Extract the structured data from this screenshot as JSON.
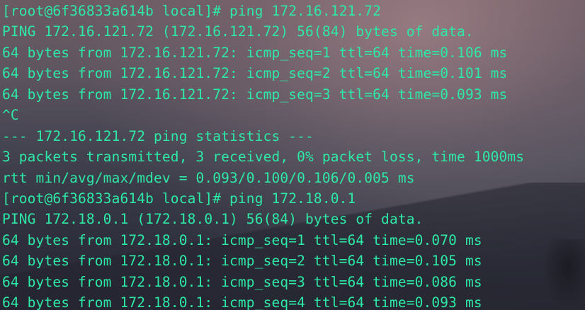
{
  "terminal": {
    "text_color": "#2ee8a6",
    "lines": [
      "[root@6f36833a614b local]# ping 172.16.121.72",
      "PING 172.16.121.72 (172.16.121.72) 56(84) bytes of data.",
      "64 bytes from 172.16.121.72: icmp_seq=1 ttl=64 time=0.106 ms",
      "64 bytes from 172.16.121.72: icmp_seq=2 ttl=64 time=0.101 ms",
      "64 bytes from 172.16.121.72: icmp_seq=3 ttl=64 time=0.093 ms",
      "^C",
      "--- 172.16.121.72 ping statistics ---",
      "3 packets transmitted, 3 received, 0% packet loss, time 1000ms",
      "rtt min/avg/max/mdev = 0.093/0.100/0.106/0.005 ms",
      "[root@6f36833a614b local]# ping 172.18.0.1",
      "PING 172.18.0.1 (172.18.0.1) 56(84) bytes of data.",
      "64 bytes from 172.18.0.1: icmp_seq=1 ttl=64 time=0.070 ms",
      "64 bytes from 172.18.0.1: icmp_seq=2 ttl=64 time=0.105 ms",
      "64 bytes from 172.18.0.1: icmp_seq=3 ttl=64 time=0.086 ms",
      "64 bytes from 172.18.0.1: icmp_seq=4 ttl=64 time=0.093 ms"
    ]
  }
}
